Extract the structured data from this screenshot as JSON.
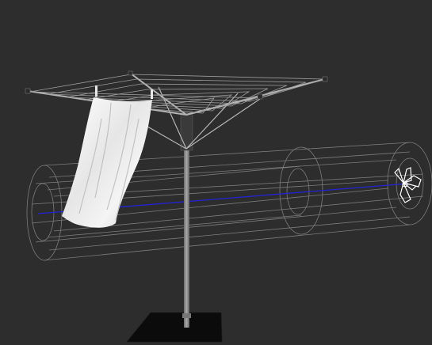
{
  "viewport": {
    "background": "#2d2d2d",
    "wire_color": "#9a9a9a",
    "gizmo_color": "#ffffff",
    "axis_color": "#1e1ecc",
    "cloth_color": "#eeeeee",
    "pole_color": "#8f8f8f",
    "base_color": "#0a0a0a"
  },
  "objects": [
    {
      "name": "rotary-clothesline",
      "icon": "clothesline-mesh"
    },
    {
      "name": "cloth-sheet",
      "icon": "cloth-mesh"
    },
    {
      "name": "wind-force-field",
      "icon": "cylinder-wireframe"
    },
    {
      "name": "fan-gizmo",
      "icon": "fan-icon"
    },
    {
      "name": "wind-axis",
      "icon": "line"
    }
  ]
}
